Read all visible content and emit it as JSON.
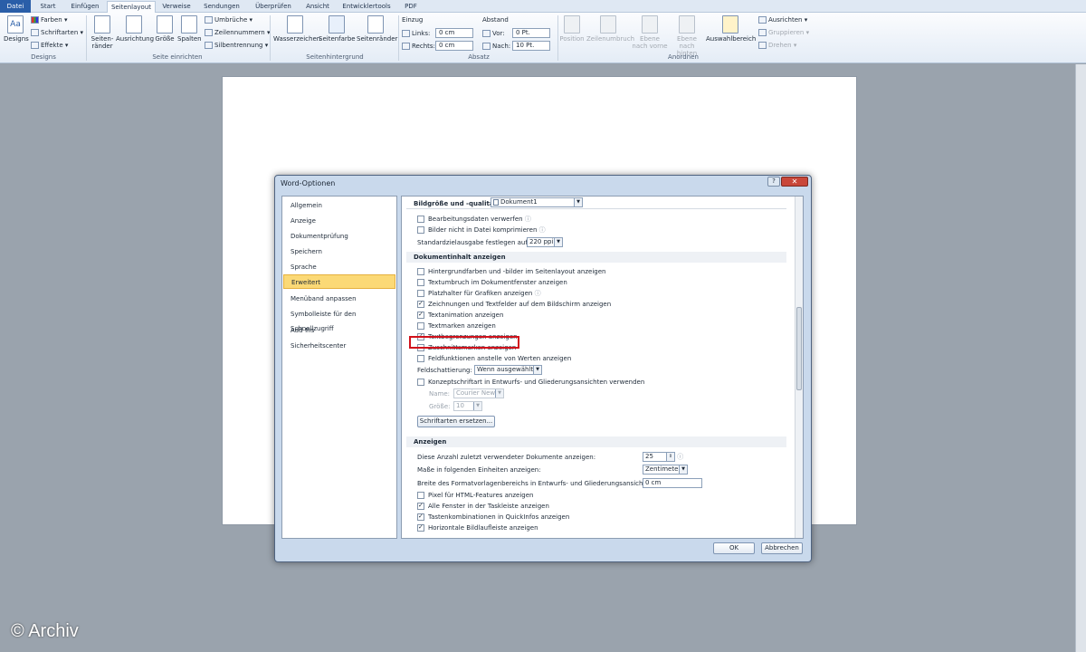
{
  "ribbon": {
    "tabs": [
      "Datei",
      "Start",
      "Einfügen",
      "Seitenlayout",
      "Verweise",
      "Sendungen",
      "Überprüfen",
      "Ansicht",
      "Entwicklertools",
      "PDF"
    ],
    "groups": {
      "designs": {
        "label": "Designs",
        "designs_btn": "Designs",
        "colors": "Farben",
        "fonts": "Schriftarten",
        "effects": "Effekte"
      },
      "page_setup": {
        "label": "Seite einrichten",
        "margins": "Seiten-\nränder",
        "orientation": "Ausrichtung",
        "size": "Größe",
        "columns": "Spalten",
        "breaks": "Umbrüche",
        "line_numbers": "Zeilennummern",
        "hyphenation": "Silbentrennung"
      },
      "page_background": {
        "label": "Seitenhintergrund",
        "watermark": "Wasserzeichen",
        "page_color": "Seitenfarbe",
        "page_borders": "Seitenränder"
      },
      "paragraph": {
        "label": "Absatz",
        "indent": "Einzug",
        "left": "Links:",
        "left_val": "0 cm",
        "right": "Rechts:",
        "right_val": "0 cm",
        "spacing": "Abstand",
        "before": "Vor:",
        "before_val": "0 Pt.",
        "after": "Nach:",
        "after_val": "10 Pt."
      },
      "arrange": {
        "label": "Anordnen",
        "position": "Position",
        "wrap": "Zeilenumbruch",
        "forward": "Ebene nach vorne",
        "backward": "Ebene nach hinten",
        "selection_pane": "Auswahlbereich",
        "align": "Ausrichten",
        "group": "Gruppieren",
        "rotate": "Drehen"
      }
    }
  },
  "dialog": {
    "title": "Word-Optionen",
    "help": "?",
    "close": "✕",
    "nav": [
      "Allgemein",
      "Anzeige",
      "Dokumentprüfung",
      "Speichern",
      "Sprache",
      "Erweitert",
      "Menüband anpassen",
      "Symbolleiste für den Schnellzugriff",
      "Add-Ins",
      "Sicherheitscenter"
    ],
    "nav_active_index": 5,
    "image_quality": {
      "label": "Bildgröße und -qualität",
      "document": "Dokument1",
      "items": [
        {
          "label": "Bearbeitungsdaten verwerfen",
          "checked": false,
          "info": "ⓘ"
        },
        {
          "label": "Bilder nicht in Datei komprimieren",
          "checked": false,
          "info": "ⓘ"
        }
      ],
      "default_output_label": "Standardzielausgabe festlegen auf:",
      "default_output_value": "220 ppi"
    },
    "show_doc_content": {
      "label": "Dokumentinhalt anzeigen",
      "items": [
        {
          "label": "Hintergrundfarben und -bilder im Seitenlayout anzeigen",
          "checked": false
        },
        {
          "label": "Textumbruch im Dokumentfenster anzeigen",
          "checked": false
        },
        {
          "label": "Platzhalter für Grafiken anzeigen",
          "checked": false,
          "info": "ⓘ"
        },
        {
          "label": "Zeichnungen und Textfelder auf dem Bildschirm anzeigen",
          "checked": true
        },
        {
          "label": "Textanimation anzeigen",
          "checked": true
        },
        {
          "label": "Textmarken anzeigen",
          "checked": false
        },
        {
          "label": "Textbegrenzungen anzeigen",
          "checked": true
        },
        {
          "label": "Zuschnittsmarken anzeigen",
          "checked": false
        },
        {
          "label": "Feldfunktionen anstelle von Werten anzeigen",
          "checked": false
        }
      ],
      "field_shading_label": "Feldschattierung:",
      "field_shading_value": "Wenn ausgewählt",
      "draft_font_label": "Konzeptschriftart in Entwurfs- und Gliederungsansichten verwenden",
      "draft_font_checked": false,
      "name_label": "Name:",
      "name_value": "Courier New",
      "size_label": "Größe:",
      "size_value": "10",
      "font_substitution": "Schriftarten ersetzen..."
    },
    "display": {
      "label": "Anzeigen",
      "recent_docs_label": "Diese Anzahl zuletzt verwendeter Dokumente anzeigen:",
      "recent_docs_value": "25",
      "units_label": "Maße in folgenden Einheiten anzeigen:",
      "units_value": "Zentimeter",
      "style_area_label": "Breite des Formatvorlagenbereichs in Entwurfs- und Gliederungsansichten:",
      "style_area_value": "0 cm",
      "items": [
        {
          "label": "Pixel für HTML-Features anzeigen",
          "checked": false
        },
        {
          "label": "Alle Fenster in der Taskleiste anzeigen",
          "checked": true
        },
        {
          "label": "Tastenkombinationen in QuickInfos anzeigen",
          "checked": true
        },
        {
          "label": "Horizontale Bildlaufleiste anzeigen",
          "checked": true
        }
      ]
    },
    "ok": "OK",
    "cancel": "Abbrechen"
  },
  "watermark": "© Archiv"
}
